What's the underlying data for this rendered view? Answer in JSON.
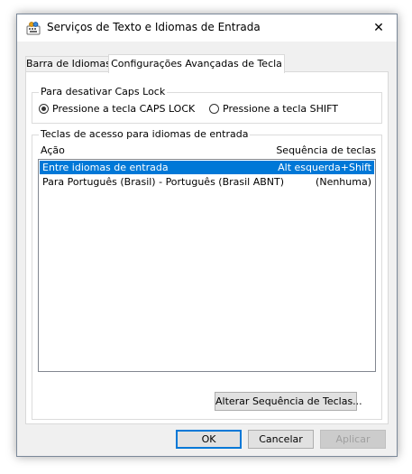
{
  "window": {
    "title": "Serviços de Texto e Idiomas de Entrada",
    "close_glyph": "✕"
  },
  "tabs": [
    {
      "label": "Barra de Idiomas",
      "active": false
    },
    {
      "label": "Configurações Avançadas de Tecla",
      "active": true
    }
  ],
  "caps_lock": {
    "label": "Para desativar Caps Lock",
    "options": [
      {
        "label": "Pressione a tecla CAPS LOCK",
        "selected": true
      },
      {
        "label": "Pressione a tecla SHIFT",
        "selected": false
      }
    ]
  },
  "hotkeys": {
    "label": "Teclas de acesso para idiomas de entrada",
    "columns": {
      "action": "Ação",
      "sequence": "Sequência de teclas"
    },
    "rows": [
      {
        "action": "Entre idiomas de entrada",
        "sequence": "Alt esquerda+Shift",
        "selected": true
      },
      {
        "action": "Para Português (Brasil) - Português (Brasil ABNT)",
        "sequence": "(Nenhuma)",
        "selected": false
      }
    ],
    "change_button": "Alterar Sequência de Teclas..."
  },
  "footer": {
    "ok": "OK",
    "cancel": "Cancelar",
    "apply": "Aplicar"
  },
  "colors": {
    "selection": "#0078d7",
    "window_bg": "#f0f0f0"
  },
  "icons": {
    "app": "keyboard-icon",
    "close": "close-icon"
  }
}
